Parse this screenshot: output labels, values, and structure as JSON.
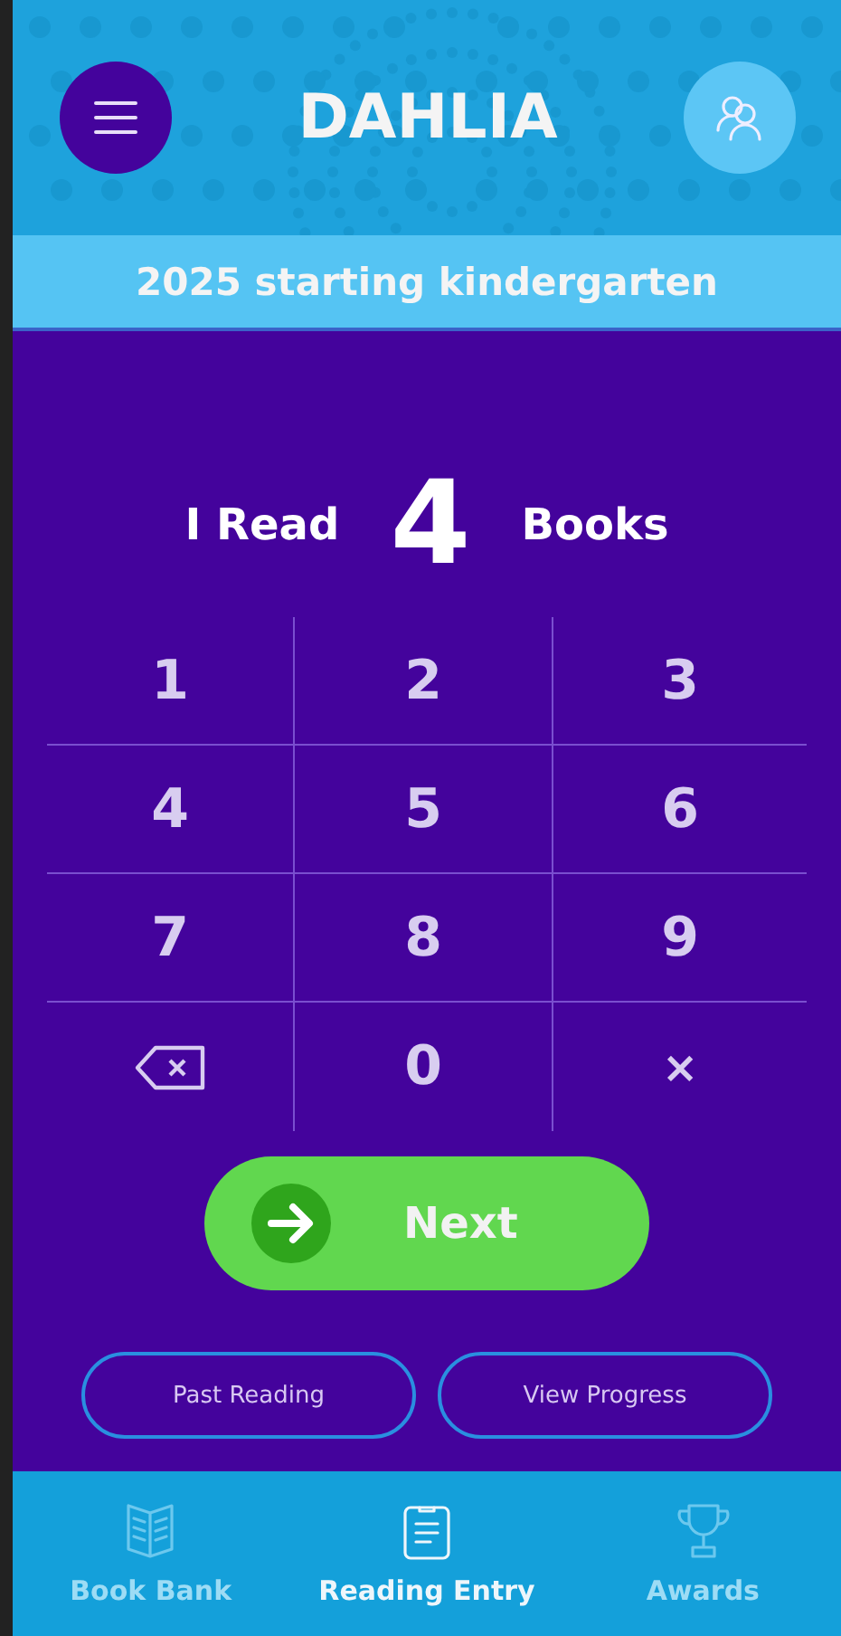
{
  "header": {
    "title": "DAHLIA"
  },
  "subtitle": "2025 starting kindergarten",
  "prompt": {
    "prefix": "I Read",
    "count": "4",
    "suffix": "Books"
  },
  "keys": [
    {
      "kind": "digit",
      "label": "1"
    },
    {
      "kind": "digit",
      "label": "2"
    },
    {
      "kind": "digit",
      "label": "3"
    },
    {
      "kind": "digit",
      "label": "4"
    },
    {
      "kind": "digit",
      "label": "5"
    },
    {
      "kind": "digit",
      "label": "6"
    },
    {
      "kind": "digit",
      "label": "7"
    },
    {
      "kind": "digit",
      "label": "8"
    },
    {
      "kind": "digit",
      "label": "9"
    },
    {
      "kind": "backspace"
    },
    {
      "kind": "digit",
      "label": "0"
    },
    {
      "kind": "clear",
      "label": "×"
    }
  ],
  "next_button": "Next",
  "links": [
    "Past Reading",
    "View Progress"
  ],
  "nav": [
    {
      "label": "Book Bank",
      "kind": "book",
      "selected": false
    },
    {
      "label": "Reading Entry",
      "kind": "clipboard",
      "selected": true
    },
    {
      "label": "Awards",
      "kind": "trophy",
      "selected": false
    }
  ]
}
